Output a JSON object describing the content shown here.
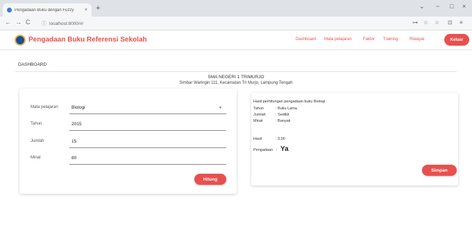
{
  "browser": {
    "tab_title": "Pengadaan Buku dengan Fuzzy",
    "tab_close": "×",
    "new_tab": "+",
    "url": "localhost:8000/#/",
    "controls": {
      "minimize": "−",
      "maximize": "□",
      "close": "×",
      "dropdown": "⌄"
    },
    "nav": {
      "back": "←",
      "forward": "→",
      "reload": "C",
      "info": "ⓘ"
    },
    "bar_icons": [
      "⊶",
      "☆",
      "☆",
      "⊡",
      "≡"
    ]
  },
  "app": {
    "brand": "Pengadaan Buku Referensi Sekolah",
    "nav_items": [
      "Dashboard",
      "Mata pelajaran",
      "Faktor",
      "Training",
      "Riwayat"
    ],
    "logout_label": "Keluar"
  },
  "page": {
    "title": "DASHBOARD",
    "school_name": "SMA NEGERI 1 TRIMURJO",
    "school_address": "Simbar Waringin 111, Kecamatan Tri Murjo, Lampung Tengah"
  },
  "form": {
    "fields": [
      {
        "label": "Mata pelajaran",
        "value": "Biologi",
        "dropdown": true
      },
      {
        "label": "Tahun",
        "value": "2015"
      },
      {
        "label": "Jumlah",
        "value": "15"
      },
      {
        "label": "Minat",
        "value": "80"
      }
    ],
    "dropdown_caret": "▾",
    "submit_label": "Hitung"
  },
  "result": {
    "heading": "Hasil perhitungan pengadaan buku Biologi",
    "rows": [
      {
        "label": "Tahun",
        "value": ": Buku Lama"
      },
      {
        "label": "Jumlah",
        "value": ": Sedikit"
      },
      {
        "label": "Minat",
        "value": ": Banyak"
      }
    ],
    "score_label": "Hasil",
    "score_value": ": 0.00",
    "decision_label": "Pengadaan",
    "decision_sep": ":",
    "decision_value": "Ya",
    "save_label": "Simpan"
  },
  "colors": {
    "accent": "#e8504f",
    "chrome": "#dfe3e8",
    "logo": "#1c4f95"
  }
}
